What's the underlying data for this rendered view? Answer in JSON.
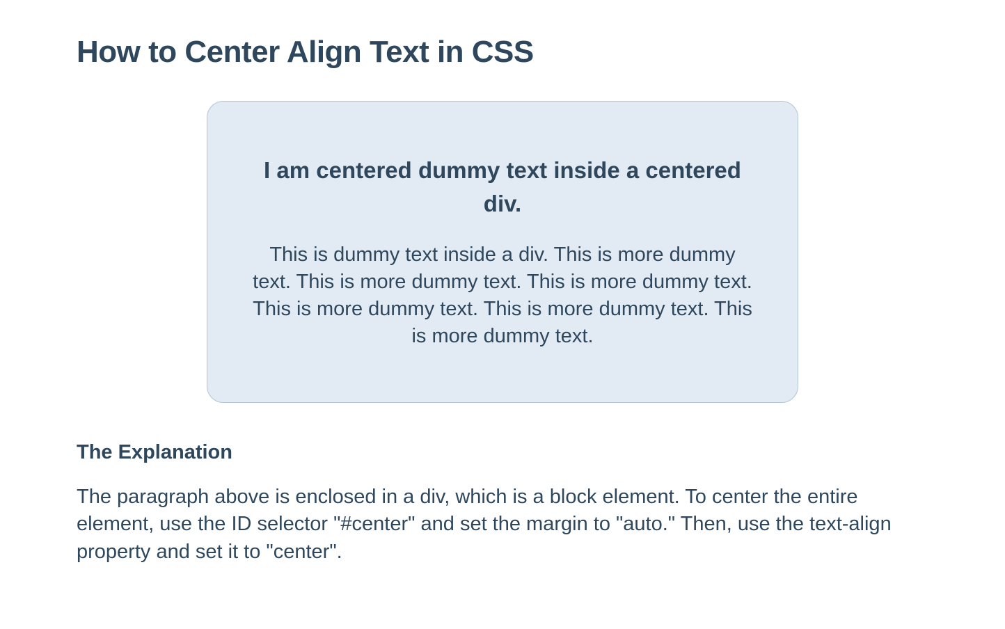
{
  "title": "How to Center Align Text in CSS",
  "box": {
    "heading": "I am centered dummy text inside a centered div.",
    "body": "This is dummy text inside a div. This is more dummy text. This is more dummy text. This is more dummy text. This is more dummy text. This is more dummy text. This is more dummy text."
  },
  "explanation": {
    "heading": "The Explanation",
    "body": "The paragraph above is enclosed in a div, which is a block element. To center the entire element, use the ID selector \"#center\" and set the margin to \"auto.\" Then, use the text-align property and set it to \"center\"."
  }
}
